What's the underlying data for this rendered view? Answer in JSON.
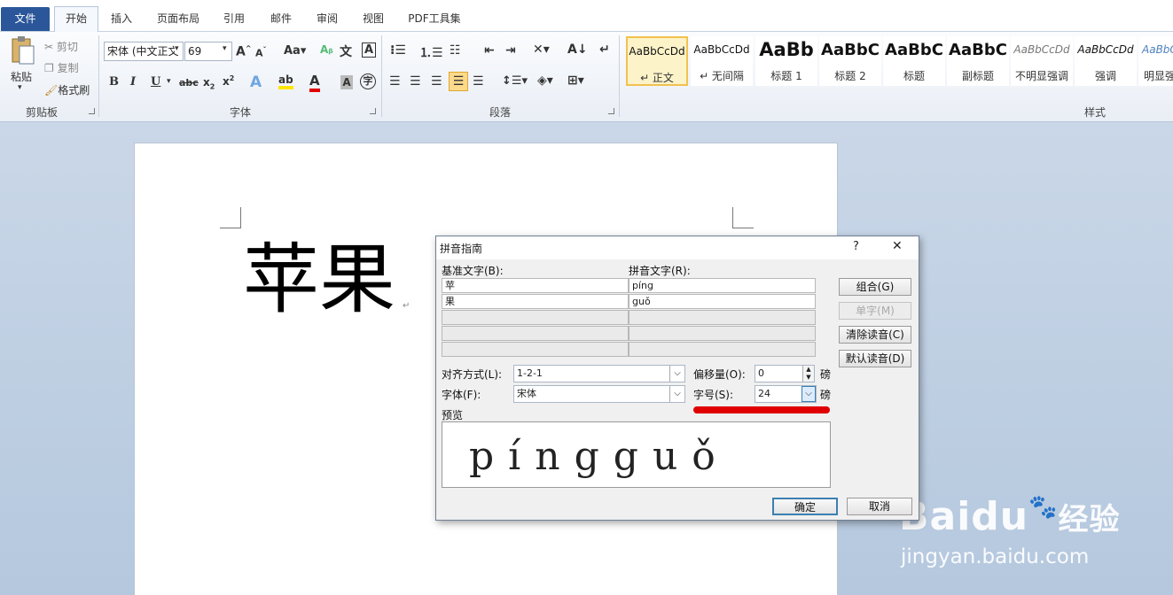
{
  "tabs": {
    "file": "文件",
    "home": "开始",
    "insert": "插入",
    "page_layout": "页面布局",
    "references": "引用",
    "mailings": "邮件",
    "review": "审阅",
    "view": "视图",
    "pdf_tools": "PDF工具集"
  },
  "clipboard": {
    "paste": "粘贴",
    "cut": "剪切",
    "copy": "复制",
    "format_painter": "格式刷",
    "label": "剪贴板"
  },
  "font_group": {
    "font_name": "宋体 (中文正文",
    "font_size": "69",
    "label": "字体",
    "icons": [
      "grow-font-icon",
      "shrink-font-icon",
      "change-case-icon",
      "clear-format-icon",
      "phonetic-guide-icon",
      "char-border-icon",
      "bold-icon",
      "italic-icon",
      "underline-icon",
      "strikethrough-icon",
      "subscript-icon",
      "superscript-icon",
      "text-effect-icon",
      "highlight-icon",
      "font-color-icon",
      "char-shading-icon",
      "enclose-char-icon"
    ]
  },
  "paragraph": {
    "label": "段落"
  },
  "styles": {
    "label": "样式",
    "items": [
      {
        "sample": "AaBbCcDd",
        "name": "↵ 正文"
      },
      {
        "sample": "AaBbCcDd",
        "name": "↵ 无间隔"
      },
      {
        "sample": "AaBb",
        "name": "标题 1"
      },
      {
        "sample": "AaBbC",
        "name": "标题 2"
      },
      {
        "sample": "AaBbC",
        "name": "标题"
      },
      {
        "sample": "AaBbC",
        "name": "副标题"
      },
      {
        "sample": "AaBbCcDd",
        "name": "不明显强调"
      },
      {
        "sample": "AaBbCcDd",
        "name": "强调"
      },
      {
        "sample": "AaBbCcDd",
        "name": "明显强"
      }
    ]
  },
  "document": {
    "text": "苹果",
    "paragraph_mark": "↵"
  },
  "dialog": {
    "title": "拼音指南",
    "help": "?",
    "close": "✕",
    "base_text_label": "基准文字(B):",
    "ruby_text_label": "拼音文字(R):",
    "rows": [
      {
        "base": "苹",
        "ruby": "píng"
      },
      {
        "base": "果",
        "ruby": "guǒ"
      }
    ],
    "buttons": {
      "group": "组合(G)",
      "mono": "单字(M)",
      "clear": "清除读音(C)",
      "default": "默认读音(D)",
      "ok": "确定",
      "cancel": "取消"
    },
    "alignment_label": "对齐方式(L):",
    "alignment_value": "1-2-1",
    "offset_label": "偏移量(O):",
    "offset_value": "0",
    "offset_unit": "磅",
    "font_label": "字体(F):",
    "font_value": "宋体",
    "size_label": "字号(S):",
    "size_value": "24",
    "size_unit": "磅",
    "preview_label": "预览",
    "preview_letters": [
      "p",
      "í",
      "n",
      "g",
      "g",
      "u",
      "ǒ"
    ]
  },
  "watermark": {
    "brand": "Baidu",
    "cn": "经验",
    "url": "jingyan.baidu.com"
  },
  "colors": {
    "file_tab": "#2b579a",
    "highlight_underline": "#e00000",
    "selected_style_border": "#f2c14e"
  }
}
